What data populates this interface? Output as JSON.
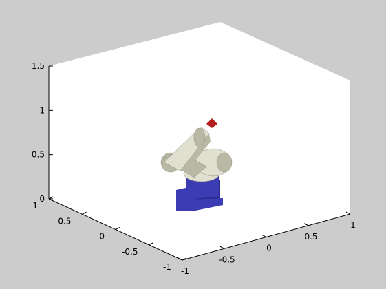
{
  "figure": {
    "background_color": "#cccccc",
    "axes_background_color": "#ffffff",
    "axis_color": "#000000"
  },
  "axes": {
    "z_ticks": [
      {
        "value": 1.5,
        "label": "1.5"
      },
      {
        "value": 1,
        "label": "1"
      },
      {
        "value": 0.5,
        "label": "0.5"
      },
      {
        "value": 0,
        "label": "0"
      }
    ],
    "y_ticks": [
      {
        "value": 1,
        "label": "1"
      },
      {
        "value": 0.5,
        "label": "0.5"
      },
      {
        "value": 0,
        "label": "0"
      },
      {
        "value": -0.5,
        "label": "-0.5"
      },
      {
        "value": -1,
        "label": "-1"
      }
    ],
    "x_ticks": [
      {
        "value": -1,
        "label": "-1"
      },
      {
        "value": -0.5,
        "label": "-0.5"
      },
      {
        "value": 0,
        "label": "0"
      },
      {
        "value": 0.5,
        "label": "0.5"
      },
      {
        "value": 1,
        "label": "1"
      }
    ],
    "x_range": [
      -1,
      1
    ],
    "y_range": [
      -1,
      1
    ],
    "z_range": [
      0,
      1.5
    ]
  },
  "robot": {
    "base_color": "#3c3cb4",
    "base_shadow_color": "#28288c",
    "arm_color": "#e0e0d0",
    "arm_shade_color": "#b8b8a4",
    "end_effector_color": "#b41e1e"
  }
}
